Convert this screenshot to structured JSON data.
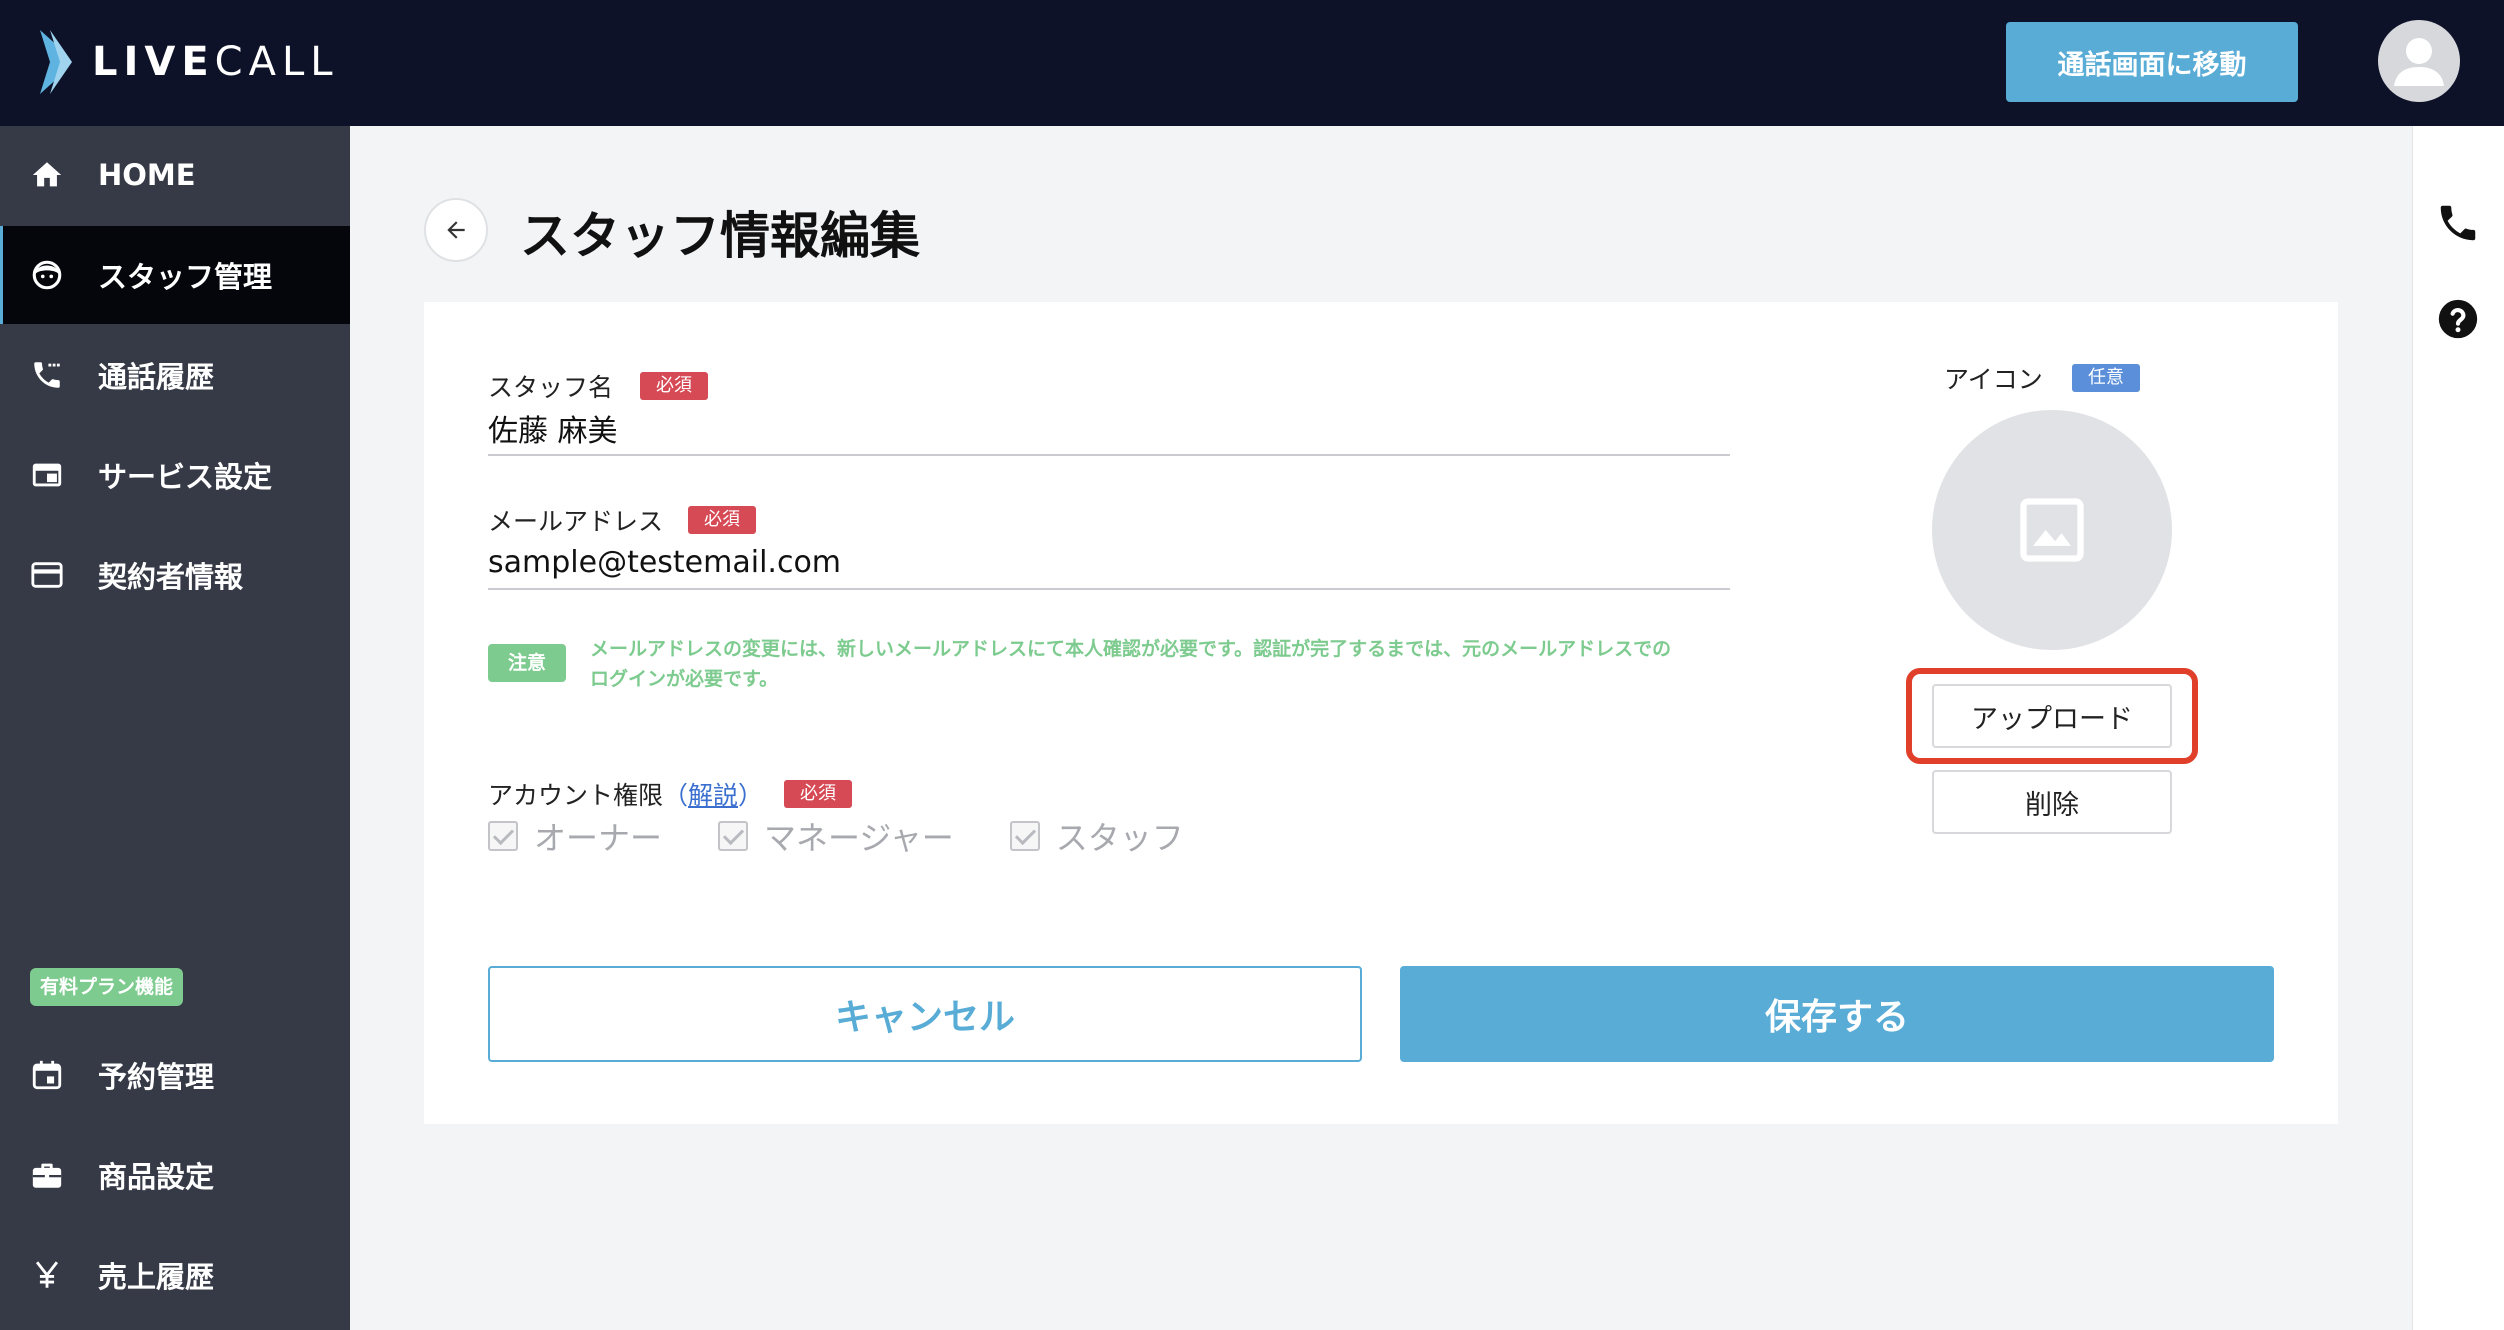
{
  "header": {
    "logo_bold": "LIVE",
    "logo_light": "CALL",
    "go_call_button": "通話画面に移動"
  },
  "sidebar": {
    "items": [
      {
        "label": "HOME",
        "icon": "home-icon"
      },
      {
        "label": "スタッフ管理",
        "icon": "staff-icon",
        "active": true
      },
      {
        "label": "通話履歴",
        "icon": "call-history-icon"
      },
      {
        "label": "サービス設定",
        "icon": "service-icon"
      },
      {
        "label": "契約者情報",
        "icon": "card-icon"
      }
    ],
    "plan_badge": "有料プラン機能",
    "plan_items": [
      {
        "label": "予約管理",
        "icon": "calendar-icon"
      },
      {
        "label": "商品設定",
        "icon": "briefcase-icon"
      },
      {
        "label": "売上履歴",
        "icon": "yen-icon"
      }
    ]
  },
  "page": {
    "title": "スタッフ情報編集"
  },
  "form": {
    "staff_name": {
      "label": "スタッフ名",
      "badge": "必須",
      "value": "佐藤 麻美"
    },
    "email": {
      "label": "メールアドレス",
      "badge": "必須",
      "value": "sample@testemail.com"
    },
    "note": {
      "badge": "注意",
      "text": "メールアドレスの変更には、新しいメールアドレスにて本人確認が必要です。認証が完了するまでは、元のメールアドレスでのログインが必要です。"
    },
    "permission": {
      "label": "アカウント権限",
      "paren_open": "（",
      "help_link": "解説",
      "paren_close": "）",
      "badge": "必須",
      "options": [
        "オーナー",
        "マネージャー",
        "スタッフ"
      ]
    },
    "icon": {
      "label": "アイコン",
      "badge": "任意",
      "upload_button": "アップロード",
      "delete_button": "削除"
    },
    "cancel_button": "キャンセル",
    "save_button": "保存する"
  },
  "colors": {
    "header_bg": "#0d1228",
    "sidebar_bg": "#363a46",
    "accent": "#58acd6",
    "required": "#d64a55",
    "optional": "#5b8fd9",
    "note": "#7dcb8f",
    "highlight": "#e0402a"
  }
}
